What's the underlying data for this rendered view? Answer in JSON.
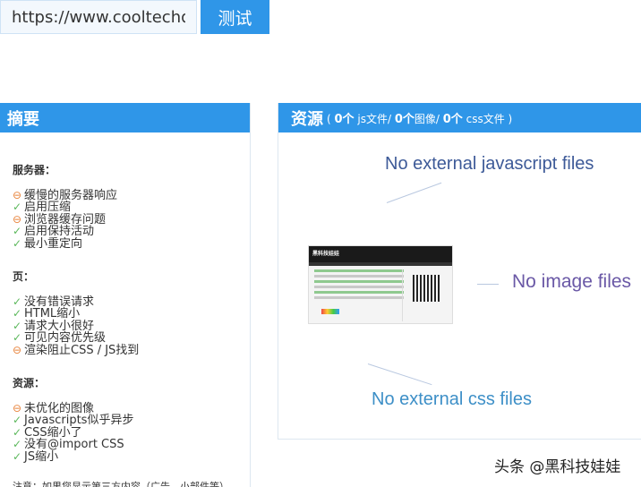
{
  "toolbar": {
    "url_value": "https://www.cooltechdo",
    "test_button_label": "测试"
  },
  "summary": {
    "title": "摘要",
    "sections": [
      {
        "title": "服务器：",
        "items": [
          {
            "status": "warn",
            "label": "缓慢的服务器响应"
          },
          {
            "status": "ok",
            "label": "启用压缩"
          },
          {
            "status": "warn",
            "label": "浏览器缓存问题"
          },
          {
            "status": "ok",
            "label": "启用保持活动"
          },
          {
            "status": "ok",
            "label": "最小重定向"
          }
        ]
      },
      {
        "title": "页：",
        "items": [
          {
            "status": "ok",
            "label": "没有错误请求"
          },
          {
            "status": "ok",
            "label": "HTML缩小"
          },
          {
            "status": "ok",
            "label": "请求大小很好"
          },
          {
            "status": "ok",
            "label": "可见内容优先级"
          },
          {
            "status": "warn",
            "label": "渲染阻止CSS / JS找到"
          }
        ]
      },
      {
        "title": "资源：",
        "items": [
          {
            "status": "warn",
            "label": "未优化的图像"
          },
          {
            "status": "ok",
            "label": "Javascripts似乎异步"
          },
          {
            "status": "ok",
            "label": "CSS缩小了"
          },
          {
            "status": "ok",
            "label": "没有@import CSS"
          },
          {
            "status": "ok",
            "label": "JS缩小"
          }
        ]
      }
    ],
    "note": "注意：如果您显示第三方内容（广告，小部件等），这些值可能会经常更改。"
  },
  "resources": {
    "title": "资源",
    "js_count": "0个",
    "js_label": "js文件",
    "img_count": "0个",
    "img_label": "图像",
    "css_count": "0个",
    "css_label": "css文件",
    "msg_js": "No external javascript files",
    "msg_images": "No image files",
    "msg_css": "No external css files",
    "thumb_logo": "黑科技娃娃"
  },
  "watermark": "头条 @黑科技娃娃",
  "status_icons": {
    "ok": "✓",
    "warn": "⊖"
  },
  "colors": {
    "accent": "#2f96e8",
    "ok": "#5cb85c",
    "warn": "#e8833a"
  }
}
